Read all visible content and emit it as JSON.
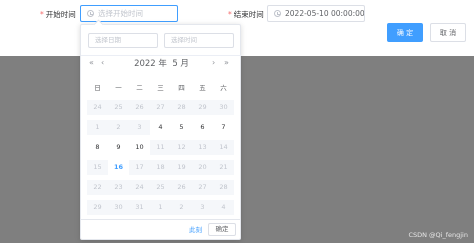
{
  "form": {
    "start_label": "开始时间",
    "start_placeholder": "选择开始时间",
    "end_label": "结束时间",
    "end_value": "2022-05-10 00:00:00",
    "required_mark": "*",
    "confirm_label": "确 定",
    "cancel_label": "取 消"
  },
  "picker": {
    "date_placeholder": "选择日期",
    "time_placeholder": "选择时间",
    "year_label": "2022 年",
    "month_label": "5 月",
    "nav_prev_year": "«",
    "nav_prev_month": "‹",
    "nav_next_month": "›",
    "nav_next_year": "»",
    "weekdays": [
      "日",
      "一",
      "二",
      "三",
      "四",
      "五",
      "六"
    ],
    "today": "16",
    "weeks": [
      [
        {
          "d": "24",
          "s": "dis"
        },
        {
          "d": "25",
          "s": "dis"
        },
        {
          "d": "26",
          "s": "dis"
        },
        {
          "d": "27",
          "s": "dis"
        },
        {
          "d": "28",
          "s": "dis"
        },
        {
          "d": "29",
          "s": "dis"
        },
        {
          "d": "30",
          "s": "dis"
        }
      ],
      [
        {
          "d": "1",
          "s": "dis"
        },
        {
          "d": "2",
          "s": "dis"
        },
        {
          "d": "3",
          "s": "dis"
        },
        {
          "d": "4",
          "s": "cur"
        },
        {
          "d": "5",
          "s": "cur"
        },
        {
          "d": "6",
          "s": "cur"
        },
        {
          "d": "7",
          "s": "cur"
        }
      ],
      [
        {
          "d": "8",
          "s": "cur"
        },
        {
          "d": "9",
          "s": "cur"
        },
        {
          "d": "10",
          "s": "cur"
        },
        {
          "d": "11",
          "s": "dis"
        },
        {
          "d": "12",
          "s": "dis"
        },
        {
          "d": "13",
          "s": "dis"
        },
        {
          "d": "14",
          "s": "dis"
        }
      ],
      [
        {
          "d": "15",
          "s": "dis"
        },
        {
          "d": "16",
          "s": "today"
        },
        {
          "d": "17",
          "s": "dis"
        },
        {
          "d": "18",
          "s": "dis"
        },
        {
          "d": "19",
          "s": "dis"
        },
        {
          "d": "20",
          "s": "dis"
        },
        {
          "d": "21",
          "s": "dis"
        }
      ],
      [
        {
          "d": "22",
          "s": "dis"
        },
        {
          "d": "23",
          "s": "dis"
        },
        {
          "d": "24",
          "s": "dis"
        },
        {
          "d": "25",
          "s": "dis"
        },
        {
          "d": "26",
          "s": "dis"
        },
        {
          "d": "27",
          "s": "dis"
        },
        {
          "d": "28",
          "s": "dis"
        }
      ],
      [
        {
          "d": "29",
          "s": "dis"
        },
        {
          "d": "30",
          "s": "dis"
        },
        {
          "d": "31",
          "s": "dis"
        },
        {
          "d": "1",
          "s": "dis"
        },
        {
          "d": "2",
          "s": "dis"
        },
        {
          "d": "3",
          "s": "dis"
        },
        {
          "d": "4",
          "s": "dis"
        }
      ]
    ],
    "now_label": "此刻",
    "ok_label": "确定"
  },
  "watermark": "CSDN @Qi_fengjin",
  "colors": {
    "accent": "#409eff",
    "required": "#f56c6c",
    "overlay": "#7f7f7f"
  },
  "icons": {
    "time_input": "clock-icon"
  }
}
